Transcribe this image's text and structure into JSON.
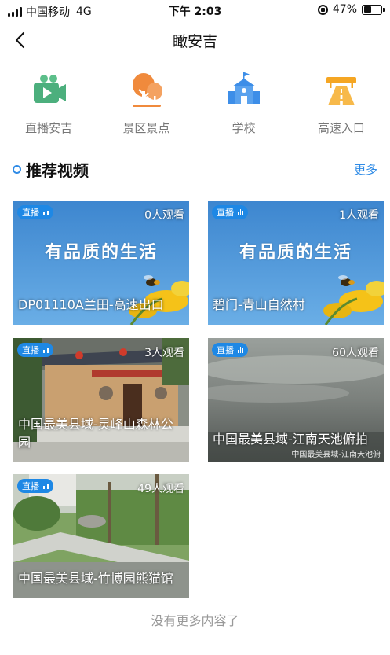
{
  "status_bar": {
    "carrier": "中国移动",
    "network": "4G",
    "time": "下午 2:03",
    "battery": "47%",
    "battery_level": 0.47
  },
  "nav": {
    "back_icon": "chevron-left-icon",
    "title": "瞰安吉"
  },
  "categories": [
    {
      "label": "直播安吉",
      "icon": "video-camera-icon",
      "color": "#4caf7d"
    },
    {
      "label": "景区景点",
      "icon": "tree-scenic-icon",
      "color": "#f08a3c"
    },
    {
      "label": "学校",
      "icon": "school-icon",
      "color": "#3d8ee8"
    },
    {
      "label": "高速入口",
      "icon": "highway-icon",
      "color": "#f5a623"
    }
  ],
  "section": {
    "title": "推荐视频",
    "more": "更多"
  },
  "videos": [
    {
      "badge": "直播",
      "viewers": "0人观看",
      "title": "DP01110A兰田-高速出口",
      "slogan": "有品质的生活"
    },
    {
      "badge": "直播",
      "viewers": "1人观看",
      "title": "碧门-青山自然村",
      "slogan": "有品质的生活"
    },
    {
      "badge": "直播",
      "viewers": "3人观看",
      "title": "中国最美县域-灵峰山森林公园"
    },
    {
      "badge": "直播",
      "viewers": "60人观看",
      "title": "中国最美县域-江南天池俯拍",
      "watermark": "中国最美县域-江南天池俯"
    },
    {
      "badge": "直播",
      "viewers": "49人观看",
      "title": "中国最美县域-竹博园熊猫馆"
    }
  ],
  "footer": "没有更多内容了",
  "colors": {
    "accent": "#2f8be6",
    "badge": "#1e88e5",
    "sky": "#4a93d8"
  }
}
